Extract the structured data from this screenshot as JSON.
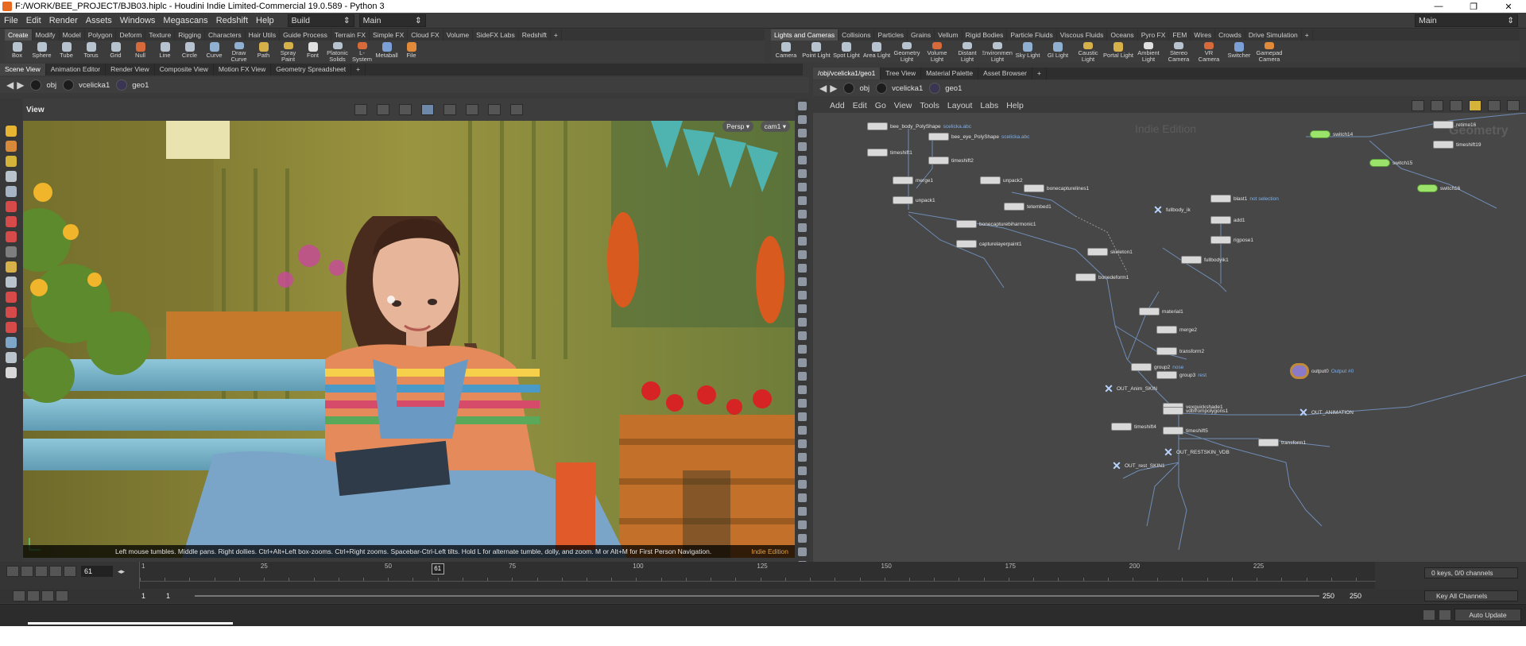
{
  "window": {
    "title": "F:/WORK/BEE_PROJECT/BJB03.hiplc - Houdini Indie Limited-Commercial 19.0.589 - Python 3",
    "min": "—",
    "max": "❐",
    "close": "✕"
  },
  "menu": {
    "items": [
      "File",
      "Edit",
      "Render",
      "Assets",
      "Windows",
      "Megascans",
      "Redshift",
      "Help"
    ],
    "desktop": "Build",
    "context": "Main",
    "right_desktop": "Main"
  },
  "shelf_left": {
    "tabs": [
      "Create",
      "Modify",
      "Model",
      "Polygon",
      "Deform",
      "Texture",
      "Rigging",
      "Characters",
      "Hair Utils",
      "Guide Process",
      "Terrain FX",
      "Simple FX",
      "Cloud FX",
      "Volume",
      "SideFX Labs",
      "Redshift"
    ],
    "tools": [
      "Box",
      "Sphere",
      "Tube",
      "Torus",
      "Grid",
      "Null",
      "Line",
      "Circle",
      "Curve",
      "Draw Curve",
      "Path",
      "Spray Paint",
      "Font",
      "Platonic Solids",
      "L-System",
      "Metaball",
      "File"
    ],
    "add": "+"
  },
  "shelf_right": {
    "tabs": [
      "Lights and Cameras",
      "Collisions",
      "Particles",
      "Grains",
      "Vellum",
      "Rigid Bodies",
      "Particle Fluids",
      "Viscous Fluids",
      "Oceans",
      "Pyro FX",
      "FEM",
      "Wires",
      "Crowds",
      "Drive Simulation"
    ],
    "tools": [
      "Camera",
      "Point Light",
      "Spot Light",
      "Area Light",
      "Geometry Light",
      "Volume Light",
      "Distant Light",
      "Environment Light",
      "Sky Light",
      "GI Light",
      "Caustic Light",
      "Portal Light",
      "Ambient Light",
      "Stereo Camera",
      "VR Camera",
      "Switcher",
      "Gamepad Camera"
    ],
    "add": "+"
  },
  "left_pane": {
    "tabs": [
      "Scene View",
      "Animation Editor",
      "Render View",
      "Composite View",
      "Motion FX View",
      "Geometry Spreadsheet"
    ],
    "path": [
      "obj",
      "vcelicka1",
      "geo1"
    ],
    "view_label": "View",
    "persp": "Persp ▾",
    "cam": "cam1 ▾",
    "hint": "Left mouse tumbles. Middle pans. Right dollies. Ctrl+Alt+Left box-zooms. Ctrl+Right zooms. Spacebar-Ctrl-Left tilts. Hold L for alternate tumble, dolly, and zoom.   M or Alt+M for First Person Navigation.",
    "watermark": "Indie Edition"
  },
  "right_pane": {
    "tabs": [
      "/obj/vcelicka1/geo1",
      "Tree View",
      "Material Palette",
      "Asset Browser"
    ],
    "path": [
      "obj",
      "vcelicka1",
      "geo1"
    ],
    "menu": [
      "Add",
      "Edit",
      "Go",
      "View",
      "Tools",
      "Layout",
      "Labs",
      "Help"
    ],
    "watermark": "Indie Edition",
    "context_label": "Geometry",
    "nodes": [
      {
        "name": "bee_body_PolyShape",
        "sub": "scelicka.abc",
        "kind": "file"
      },
      {
        "name": "bee_eye_PolyShape",
        "sub": "scelicka.abc",
        "kind": "file"
      },
      {
        "name": "timeshift1",
        "sub": "",
        "kind": "box"
      },
      {
        "name": "timeshift2",
        "sub": "",
        "kind": "box"
      },
      {
        "name": "merge1",
        "sub": "",
        "kind": "box"
      },
      {
        "name": "unpack1",
        "sub": "",
        "kind": "box"
      },
      {
        "name": "unpack2",
        "sub": "",
        "kind": "box"
      },
      {
        "name": "bonecapturelines1",
        "sub": "",
        "kind": "box"
      },
      {
        "name": "tetembed1",
        "sub": "",
        "kind": "box"
      },
      {
        "name": "bonecapturebiharmonic1",
        "sub": "",
        "kind": "box"
      },
      {
        "name": "capturelayerpaint1",
        "sub": "",
        "kind": "box"
      },
      {
        "name": "fullbody_ik",
        "sub": "",
        "kind": "x"
      },
      {
        "name": "blast1",
        "sub": "not selection",
        "kind": "box"
      },
      {
        "name": "add1",
        "sub": "",
        "kind": "box"
      },
      {
        "name": "rigpose1",
        "sub": "",
        "kind": "box"
      },
      {
        "name": "skeleton1",
        "sub": "",
        "kind": "box"
      },
      {
        "name": "fullbodyik1",
        "sub": "",
        "kind": "box"
      },
      {
        "name": "bonedeform1",
        "sub": "",
        "kind": "box"
      },
      {
        "name": "material1",
        "sub": "",
        "kind": "box"
      },
      {
        "name": "merge2",
        "sub": "",
        "kind": "box"
      },
      {
        "name": "transform2",
        "sub": "",
        "kind": "box"
      },
      {
        "name": "group2",
        "sub": "nose",
        "kind": "box"
      },
      {
        "name": "group3",
        "sub": "rest",
        "kind": "box"
      },
      {
        "name": "output0",
        "sub": "Output #0",
        "kind": "out"
      },
      {
        "name": "OUT_Anim_SKIN",
        "sub": "",
        "kind": "x"
      },
      {
        "name": "vexquickshade1",
        "sub": "",
        "kind": "box"
      },
      {
        "name": "vdbfrompolygons1",
        "sub": "",
        "kind": "box"
      },
      {
        "name": "OUT_ANIMATION",
        "sub": "",
        "kind": "x"
      },
      {
        "name": "timeshift4",
        "sub": "",
        "kind": "box"
      },
      {
        "name": "timeshift5",
        "sub": "",
        "kind": "box"
      },
      {
        "name": "transform1",
        "sub": "",
        "kind": "box"
      },
      {
        "name": "OUT_RESTSKIN_VDB",
        "sub": "",
        "kind": "x"
      },
      {
        "name": "OUT_rest_SKIN1",
        "sub": "",
        "kind": "x"
      },
      {
        "name": "switch14",
        "sub": "",
        "kind": "green"
      },
      {
        "name": "switch15",
        "sub": "",
        "kind": "green"
      },
      {
        "name": "switch16",
        "sub": "",
        "kind": "green"
      },
      {
        "name": "retime16",
        "sub": "",
        "kind": "box"
      },
      {
        "name": "timeshift19",
        "sub": "",
        "kind": "box"
      }
    ]
  },
  "timeline": {
    "frame": "61",
    "current_frame_marker": "61",
    "ticks": [
      "1",
      "25",
      "50",
      "75",
      "100",
      "125",
      "150",
      "175",
      "200",
      "225"
    ],
    "start": "1",
    "start2": "1",
    "end": "250",
    "end2": "250",
    "keys": "0 keys, 0/0 channels",
    "key_all": "Key All Channels",
    "auto_update": "Auto Update"
  }
}
